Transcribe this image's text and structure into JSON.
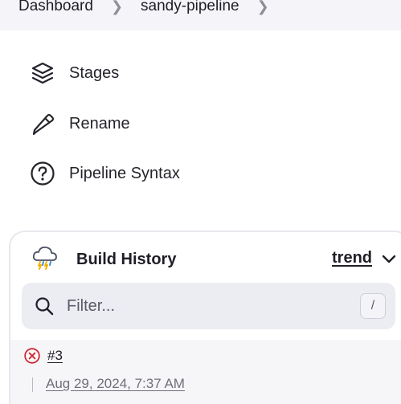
{
  "breadcrumb": {
    "items": [
      {
        "label": "Dashboard"
      },
      {
        "label": "sandy-pipeline"
      }
    ]
  },
  "side_menu": {
    "items": [
      {
        "label": "Stages",
        "icon": "stages-layers-icon"
      },
      {
        "label": "Rename",
        "icon": "pencil-icon"
      },
      {
        "label": "Pipeline Syntax",
        "icon": "help-circle-icon"
      }
    ]
  },
  "build_history": {
    "title": "Build History",
    "trend_label": "trend",
    "filter": {
      "placeholder": "Filter...",
      "shortcut": "/"
    },
    "builds": [
      {
        "number": "#3",
        "date": "Aug 29, 2024, 7:37 AM",
        "status": "failed"
      }
    ]
  },
  "colors": {
    "breadcrumb_bg": "#f5f5f9",
    "filter_bg": "#ececf3",
    "failed": "#d0282f",
    "text": "#1e1e26"
  }
}
